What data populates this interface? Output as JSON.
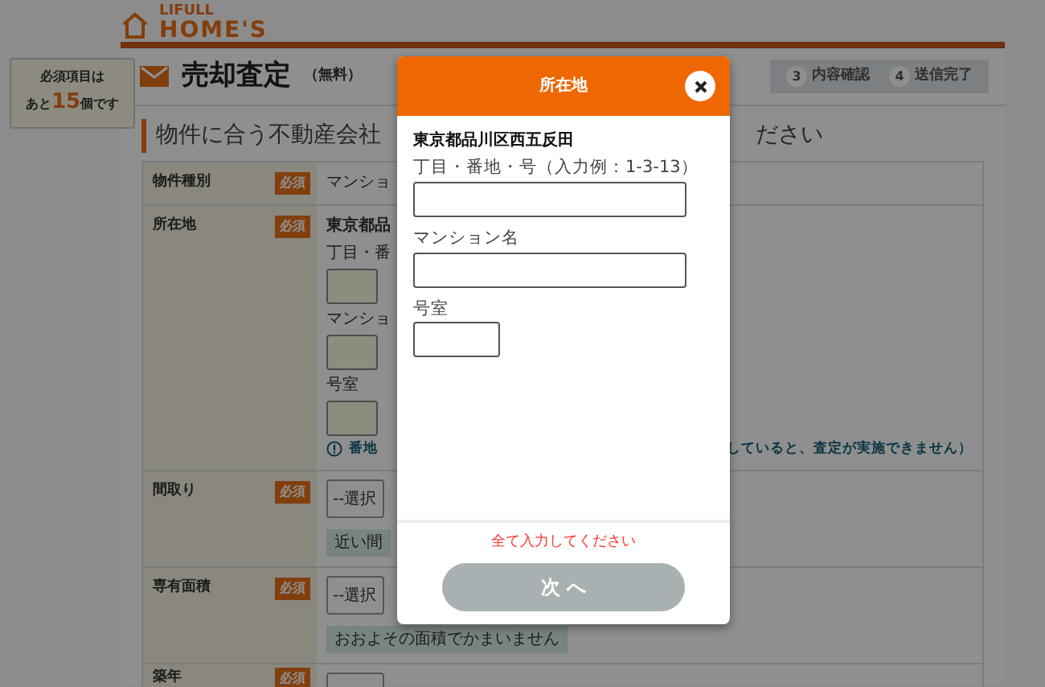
{
  "logo": {
    "small": "LIFULL",
    "main": "HOME'S"
  },
  "remaining": {
    "line1": "必須項目は",
    "prefix": "あと",
    "count": "15",
    "suffix": "個です"
  },
  "header": {
    "title": "売却査定",
    "note": "（無料）"
  },
  "steps": [
    {
      "number": "3",
      "label": "内容確認"
    },
    {
      "number": "4",
      "label": "送信完了"
    }
  ],
  "heading": {
    "left": "物件に合う不動産会社",
    "right": "ださい"
  },
  "form_rows": [
    {
      "label": "物件種別",
      "badge": "必須",
      "items": [
        {
          "kind": "value",
          "text": "マンショ"
        }
      ]
    },
    {
      "label": "所在地",
      "badge": "必須",
      "items": [
        {
          "kind": "strong",
          "text": "東京都品"
        },
        {
          "kind": "caption",
          "text": "丁目・番"
        },
        {
          "kind": "input"
        },
        {
          "kind": "caption",
          "text": "マンショ"
        },
        {
          "kind": "input"
        },
        {
          "kind": "caption",
          "text": "号室"
        },
        {
          "kind": "input"
        },
        {
          "kind": "note",
          "left": "番地",
          "right": "していると、査定が実施できません）"
        }
      ]
    },
    {
      "label": "間取り",
      "badge": "必須",
      "items": [
        {
          "kind": "select",
          "text": "--選択"
        },
        {
          "kind": "hint",
          "text": "近い間"
        }
      ]
    },
    {
      "label": "専有面積",
      "badge": "必須",
      "items": [
        {
          "kind": "select",
          "text": "--選択"
        },
        {
          "kind": "hint",
          "text": "おおよその面積でかまいません"
        }
      ]
    },
    {
      "label": "築年",
      "badge": "必須",
      "items": [
        {
          "kind": "select"
        }
      ]
    }
  ],
  "modal": {
    "title": "所在地",
    "address": "東京都品川区西五反田",
    "fields": [
      {
        "label": "丁目・番地・号（入力例：1-3-13）",
        "kind": "wide"
      },
      {
        "label": "マンション名",
        "kind": "wide"
      },
      {
        "label": "号室",
        "kind": "short"
      }
    ],
    "error": "全て入力してください",
    "button": {
      "label": "次 へ",
      "disabled": true
    }
  }
}
